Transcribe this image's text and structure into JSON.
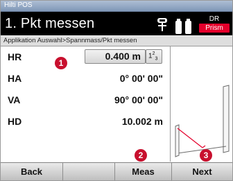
{
  "window": {
    "title": "Hilti POS"
  },
  "header": {
    "title": "1. Pkt messen",
    "mode_label": "DR",
    "target_badge": "Prism"
  },
  "breadcrumb": "Applikation Auswahl>Spannmass/Pkt messen",
  "measurements": [
    {
      "label": "HR",
      "value": "0.400 m",
      "unit_button": "123"
    },
    {
      "label": "HA",
      "value": "0° 00' 00\""
    },
    {
      "label": "VA",
      "value": "90° 00' 00\""
    },
    {
      "label": "HD",
      "value": "10.002 m"
    }
  ],
  "callouts": [
    "1",
    "2",
    "3"
  ],
  "softkeys": {
    "back": "Back",
    "empty1": "",
    "meas": "Meas",
    "next": "Next"
  },
  "colors": {
    "accent": "#e4002b",
    "callout": "#c8102e",
    "header_bg": "#000000"
  },
  "icons": [
    "prism-pole-icon",
    "battery-icon",
    "battery-icon"
  ]
}
